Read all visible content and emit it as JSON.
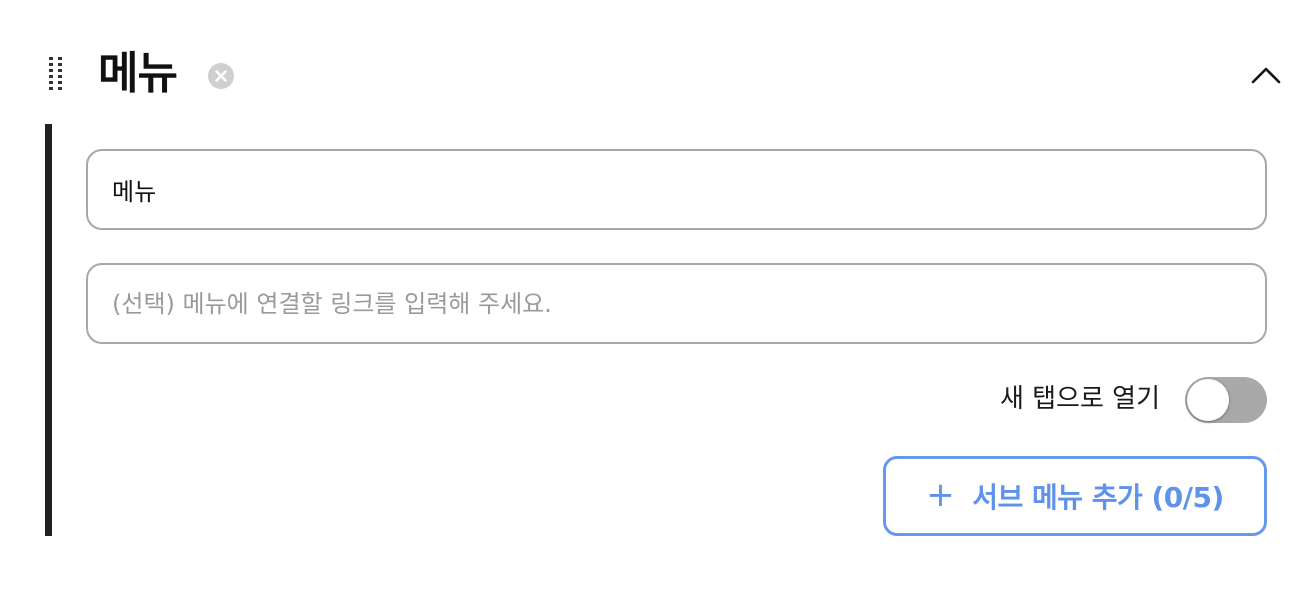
{
  "header": {
    "title": "메뉴",
    "drag_icon": "drag-handle-icon",
    "remove_icon": "close-circle-icon",
    "collapse_icon": "chevron-up-icon"
  },
  "form": {
    "name_value": "메뉴",
    "link_value": "",
    "link_placeholder": "(선택) 메뉴에 연결할 링크를 입력해 주세요.",
    "new_tab_label": "새 탭으로 열기",
    "new_tab_enabled": false,
    "add_submenu_label": "서브 메뉴 추가 (0/5)"
  },
  "colors": {
    "accent_blue": "#5f92ea",
    "toggle_off": "#a9a9a9",
    "border": "#a8a8a8",
    "bar": "#222222"
  }
}
